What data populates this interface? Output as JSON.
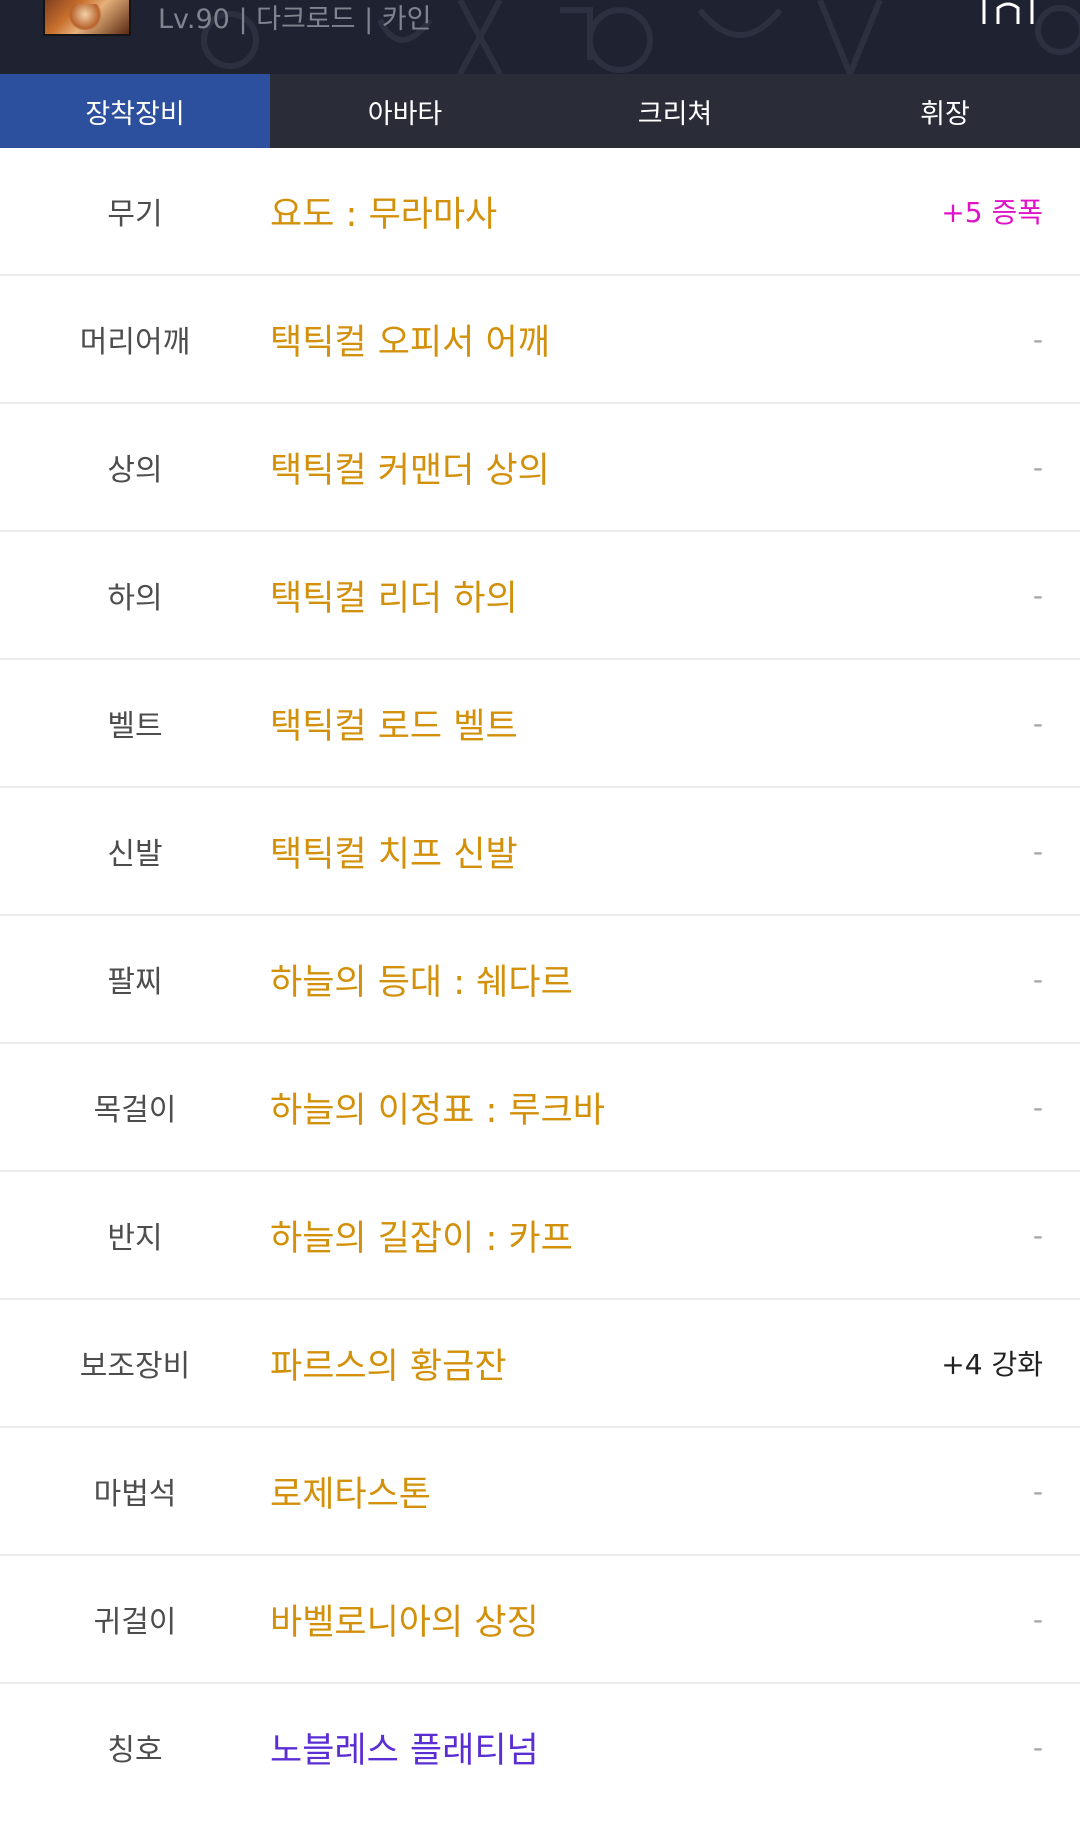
{
  "header": {
    "char_info": "Lv.90 | 다크로드 | 카인"
  },
  "tabs": [
    {
      "label": "장착장비",
      "active": true
    },
    {
      "label": "아바타",
      "active": false
    },
    {
      "label": "크리쳐",
      "active": false
    },
    {
      "label": "휘장",
      "active": false
    }
  ],
  "colors": {
    "active_tab": "#2c4f9e",
    "item_orange": "#d3900a",
    "item_purple": "#5b2ed3",
    "amplify_magenta": "#e012c8"
  },
  "equipment": [
    {
      "slot": "무기",
      "item": "요도 : 무라마사",
      "enhance": "+5 증폭"
    },
    {
      "slot": "머리어깨",
      "item": "택틱컬 오피서 어깨",
      "enhance": "-"
    },
    {
      "slot": "상의",
      "item": "택틱컬 커맨더 상의",
      "enhance": "-"
    },
    {
      "slot": "하의",
      "item": "택틱컬 리더 하의",
      "enhance": "-"
    },
    {
      "slot": "벨트",
      "item": "택틱컬 로드 벨트",
      "enhance": "-"
    },
    {
      "slot": "신발",
      "item": "택틱컬 치프 신발",
      "enhance": "-"
    },
    {
      "slot": "팔찌",
      "item": "하늘의 등대 : 쉐다르",
      "enhance": "-"
    },
    {
      "slot": "목걸이",
      "item": "하늘의 이정표 : 루크바",
      "enhance": "-"
    },
    {
      "slot": "반지",
      "item": "하늘의 길잡이 : 카프",
      "enhance": "-"
    },
    {
      "slot": "보조장비",
      "item": "파르스의 황금잔",
      "enhance": "+4 강화"
    },
    {
      "slot": "마법석",
      "item": "로제타스톤",
      "enhance": "-"
    },
    {
      "slot": "귀걸이",
      "item": "바벨로니아의 상징",
      "enhance": "-"
    },
    {
      "slot": "칭호",
      "item": "노블레스 플래티넘",
      "enhance": "-"
    }
  ]
}
